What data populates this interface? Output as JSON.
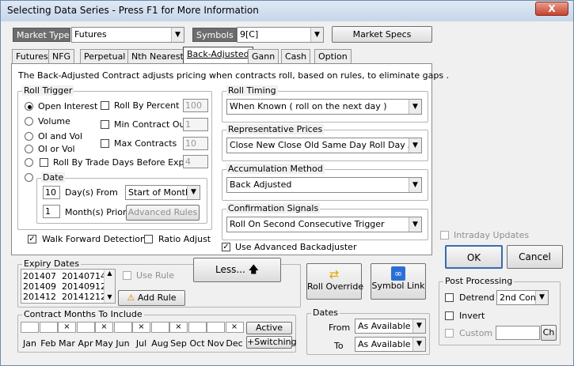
{
  "window": {
    "title": "Selecting Data Series - Press F1 for More Information",
    "close": "X"
  },
  "market_type": {
    "label": "Market Type",
    "value": "Futures"
  },
  "symbols": {
    "label": "Symbols",
    "value": "9[C]"
  },
  "market_specs_button": "Market Specs",
  "tabs": [
    "Futures",
    "NFG",
    "Perpetual",
    "Nth Nearest",
    "Back-Adjusted",
    "Gann",
    "Cash",
    "Option"
  ],
  "description": "The Back-Adjusted Contract adjusts pricing when contracts roll,  based on rules, to eliminate gaps .",
  "roll_trigger": {
    "title": "Roll Trigger",
    "options": [
      "Open Interest",
      "Volume",
      "OI and Vol",
      "OI or Vol",
      "",
      "Date"
    ],
    "roll_by_percent": {
      "label": "Roll By Percent",
      "value": "100"
    },
    "min_contract_out": {
      "label": "Min Contract Out",
      "value": "1"
    },
    "max_contracts": {
      "label": "Max Contracts",
      "value": "10"
    },
    "roll_by_trade_days": {
      "label": "Roll By Trade Days Before Expiry",
      "value": "4"
    },
    "days_from": {
      "value": "10",
      "label": "Day(s) From",
      "select": "Start of Month"
    },
    "months_prior": {
      "value": "1",
      "label": "Month(s) Prior"
    },
    "advanced_rules": "Advanced Rules",
    "walk_forward": "Walk Forward Detection",
    "ratio_adjust": "Ratio Adjust"
  },
  "roll_timing": {
    "title": "Roll Timing",
    "value": "When Known ( roll on the next day )"
  },
  "representative_prices": {
    "title": "Representative Prices",
    "value": "Close New Close Old Same Day Roll Day Adjust"
  },
  "accumulation_method": {
    "title": "Accumulation Method",
    "value": "Back Adjusted"
  },
  "confirmation_signals": {
    "title": "Confirmation Signals",
    "value": "Roll On Second Consecutive Trigger"
  },
  "use_advanced_backadjuster": "Use Advanced Backadjuster",
  "intraday_updates": "Intraday Updates",
  "ok_button": "OK",
  "cancel_button": "Cancel",
  "expiry_dates": {
    "title": "Expiry Dates",
    "rows": [
      [
        "201407",
        "20140714"
      ],
      [
        "201409",
        "20140912"
      ],
      [
        "201412",
        "20141212"
      ]
    ],
    "use_rule": "Use Rule",
    "add_rule": "Add Rule",
    "less": "Less..."
  },
  "roll_override": "Roll Override",
  "symbol_link": "Symbol Link",
  "post_processing": {
    "title": "Post Processing",
    "detrend": "Detrend",
    "detrend_select": "2nd Conti",
    "invert": "Invert",
    "custom": "Custom",
    "ch_button": "Ch"
  },
  "contract_months": {
    "title": "Contract Months To Include",
    "months": [
      "Jan",
      "Feb",
      "Mar",
      "Apr",
      "May",
      "Jun",
      "Jul",
      "Aug",
      "Sep",
      "Oct",
      "Nov",
      "Dec"
    ],
    "checked": [
      false,
      false,
      true,
      false,
      true,
      false,
      true,
      false,
      true,
      false,
      false,
      true
    ],
    "active": "Active",
    "switching": "+Switching"
  },
  "dates": {
    "title": "Dates",
    "from_label": "From",
    "from_value": "As Available",
    "to_label": "To",
    "to_value": "As Available"
  }
}
